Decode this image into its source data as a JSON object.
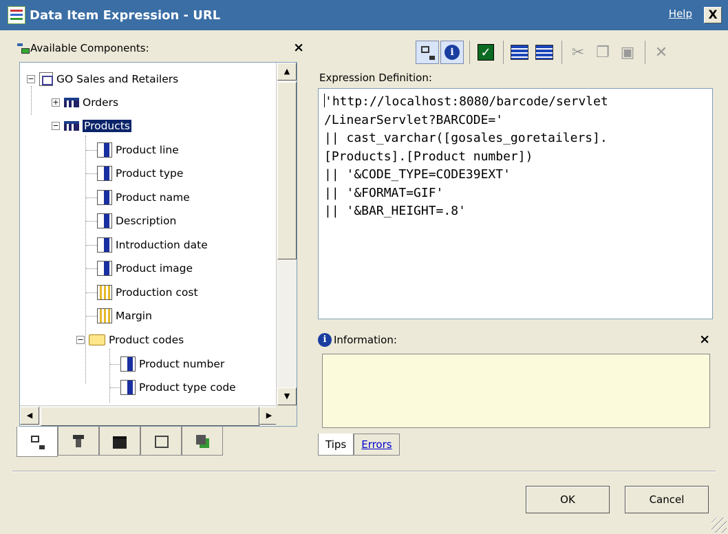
{
  "window": {
    "title": "Data Item Expression - URL",
    "help_label": "Help",
    "close_label": "X"
  },
  "components_pane": {
    "title": "Available Components:",
    "close_label": "×",
    "tree": {
      "root": "GO Sales and Retailers",
      "orders": "Orders",
      "products": "Products",
      "items": [
        "Product line",
        "Product type",
        "Product name",
        "Description",
        "Introduction date",
        "Product image"
      ],
      "measures": [
        "Production cost",
        "Margin"
      ],
      "folder": "Product codes",
      "folder_items": [
        "Product number",
        "Product type code"
      ]
    },
    "tabs": [
      "model-icon",
      "functions-icon",
      "query-items-icon",
      "parameters-icon",
      "data-sources-icon"
    ]
  },
  "toolbar": {
    "buttons": [
      "tree-view-icon",
      "info-icon",
      "validate-icon",
      "query-icon-1",
      "query-icon-2",
      "cut-icon",
      "copy-icon",
      "paste-icon",
      "delete-icon"
    ]
  },
  "expression": {
    "label": "Expression Definition:",
    "lines": [
      "'http://localhost:8080/barcode/servlet",
      "/LinearServlet?BARCODE='",
      "|| cast_varchar([gosales_goretailers].",
      "[Products].[Product number])",
      "|| '&CODE_TYPE=CODE39EXT'",
      "|| '&FORMAT=GIF'",
      "|| '&BAR_HEIGHT=.8'"
    ]
  },
  "information": {
    "title": "Information:",
    "close_label": "×",
    "content": ""
  },
  "info_tabs": {
    "tips": "Tips",
    "errors": "Errors"
  },
  "buttons": {
    "ok": "OK",
    "cancel": "Cancel"
  }
}
